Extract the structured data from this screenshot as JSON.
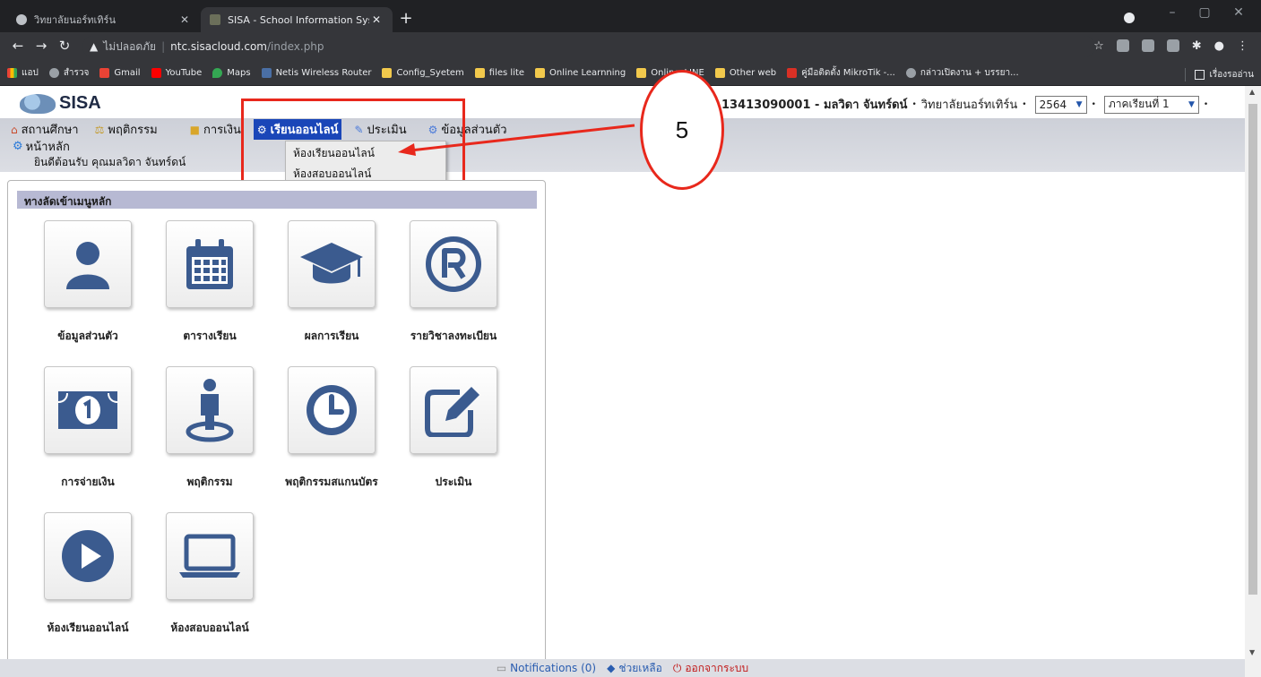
{
  "browser": {
    "tabs": [
      {
        "title": "วิทยาลัยนอร์ทเทิร์น",
        "active": false
      },
      {
        "title": "SISA - School Information System",
        "active": true
      }
    ],
    "address": {
      "insecure_label": "ไม่ปลอดภัย",
      "host": "ntc.sisacloud.com",
      "path": "/index.php"
    },
    "bookmarks": [
      {
        "label": "แอป",
        "icon": "apps-icon"
      },
      {
        "label": "สำรวจ",
        "icon": "globe-icon"
      },
      {
        "label": "Gmail",
        "icon": "gmail-icon"
      },
      {
        "label": "YouTube",
        "icon": "youtube-icon"
      },
      {
        "label": "Maps",
        "icon": "maps-icon"
      },
      {
        "label": "Netis Wireless Router",
        "icon": "netis-icon"
      },
      {
        "label": "Config_Syetem",
        "icon": "folder-icon"
      },
      {
        "label": "files lite",
        "icon": "folder-icon"
      },
      {
        "label": "Online Learnning",
        "icon": "folder-icon"
      },
      {
        "label": "Online_LINE",
        "icon": "folder-icon"
      },
      {
        "label": "Other web",
        "icon": "folder-icon"
      },
      {
        "label": "คู่มือติดตั้ง MikroTik -...",
        "icon": "mikrotik-icon"
      },
      {
        "label": "กล่าวเปิดงาน + บรรยา...",
        "icon": "globe-icon"
      }
    ],
    "reading_list": "เรื่องรออ่าน"
  },
  "header": {
    "logo_text": "SISA",
    "student_id": "13413090001 - มลวิดา จันทร์ดน์",
    "college": "วิทยาลัยนอร์ทเทิร์น",
    "year": "2564",
    "term": "ภาคเรียนที่ 1"
  },
  "menu": {
    "items": [
      {
        "label": "สถานศึกษา",
        "icon": "home-icon"
      },
      {
        "label": "พฤติกรรม",
        "icon": "scale-icon"
      },
      {
        "label": "การเงิน",
        "icon": "money-icon"
      },
      {
        "label": "เรียนออนไลน์",
        "icon": "gear-icon"
      },
      {
        "label": "ประเมิน",
        "icon": "edit-icon"
      },
      {
        "label": "ข้อมูลส่วนตัว",
        "icon": "user-gear-icon"
      }
    ],
    "home": "หน้าหลัก",
    "welcome": "ยินดีต้อนรับ คุณมลวิดา จันทร์ดน์",
    "dropdown": [
      "ห้องเรียนออนไลน์",
      "ห้องสอบออนไลน์"
    ]
  },
  "annotation": {
    "callout_number": "5"
  },
  "colors": {
    "accent": "#1a46b8",
    "annotation": "#e8281c",
    "panel_title_bg": "#b7b9d3",
    "icon": "#3b5b8f"
  },
  "panel": {
    "title": "ทางลัดเข้าเมนูหลัก",
    "tiles": [
      {
        "label": "ข้อมูลส่วนตัว",
        "icon": "user-icon"
      },
      {
        "label": "ตารางเรียน",
        "icon": "calendar-icon"
      },
      {
        "label": "ผลการเรียน",
        "icon": "graduation-cap-icon"
      },
      {
        "label": "รายวิชาลงทะเบียน",
        "icon": "registered-icon"
      },
      {
        "label": "การจ่ายเงิน",
        "icon": "money-bill-icon"
      },
      {
        "label": "พฤติกรรม",
        "icon": "person-pin-icon"
      },
      {
        "label": "พฤติกรรมสแกนบัตร",
        "icon": "clock-icon"
      },
      {
        "label": "ประเมิน",
        "icon": "edit-icon"
      },
      {
        "label": "ห้องเรียนออนไลน์",
        "icon": "play-icon"
      },
      {
        "label": "ห้องสอบออนไลน์",
        "icon": "laptop-icon"
      }
    ]
  },
  "footer": {
    "notifications": "Notifications (0)",
    "help": "ช่วยเหลือ",
    "logout": "ออกจากระบบ"
  }
}
